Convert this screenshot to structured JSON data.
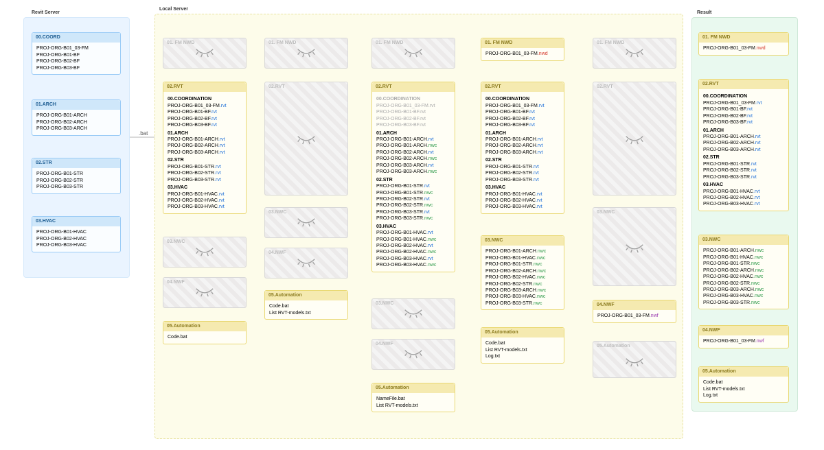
{
  "regions": {
    "revit": {
      "title": "Revit Server"
    },
    "local": {
      "title": "Local Server"
    },
    "result": {
      "title": "Result"
    }
  },
  "bat_label": ".bat",
  "closed_titles": {
    "fm_nwd": "01. FM NWD",
    "rvt": "02.RVT",
    "nwc": "03.NWC",
    "nwf": "04.NWF",
    "automation": "05.Automation"
  },
  "revit": {
    "coord": {
      "title": "00.COORD",
      "items": [
        "PROJ-ORG-B01_03-FM",
        "PROJ-ORG-B01-BF",
        "PROJ-ORG-B02-BF",
        "PROJ-ORG-B03-BF"
      ]
    },
    "arch": {
      "title": "01.ARCH",
      "items": [
        "PROJ-ORG-B01-ARCH",
        "PROJ-ORG-B02-ARCH",
        "PROJ-ORG-B03-ARCH"
      ]
    },
    "str": {
      "title": "02.STR",
      "items": [
        "PROJ-ORG-B01-STR",
        "PROJ-ORG-B02-STR",
        "PROJ-ORG-B03-STR"
      ]
    },
    "hvac": {
      "title": "03.HVAC",
      "items": [
        "PROJ-ORG-B01-HVAC",
        "PROJ-ORG-B02-HVAC",
        "PROJ-ORG-B03-HVAC"
      ]
    }
  },
  "step2_rvt": {
    "title": "02.RVT",
    "sections": [
      {
        "name": "00.COORDINATION",
        "items": [
          {
            "t": "PROJ-ORG-B01_03-FM",
            "e": "rvt"
          },
          {
            "t": "PROJ-ORG-B01-BF",
            "e": "rvt"
          },
          {
            "t": "PROJ-ORG-B02-BF",
            "e": "rvt"
          },
          {
            "t": "PROJ-ORG-B03-BF",
            "e": "rvt"
          }
        ]
      },
      {
        "name": "01.ARCH",
        "items": [
          {
            "t": "PROJ-ORG-B01-ARCH",
            "e": "rvt"
          },
          {
            "t": "PROJ-ORG-B02-ARCH",
            "e": "rvt"
          },
          {
            "t": "PROJ-ORG-B03-ARCH",
            "e": "rvt"
          }
        ]
      },
      {
        "name": "02.STR",
        "items": [
          {
            "t": "PROJ-ORG-B01-STR",
            "e": "rvt"
          },
          {
            "t": "PROJ-ORG-B02-STR",
            "e": "rvt"
          },
          {
            "t": "PROJ-ORG-B03-STR",
            "e": "rvt"
          }
        ]
      },
      {
        "name": "03.HVAC",
        "items": [
          {
            "t": "PROJ-ORG-B01-HVAC",
            "e": "rvt"
          },
          {
            "t": "PROJ-ORG-B02-HVAC",
            "e": "rvt"
          },
          {
            "t": "PROJ-ORG-B03-HVAC",
            "e": "rvt"
          }
        ]
      }
    ]
  },
  "step2_auto": {
    "title": "05.Automation",
    "items": [
      "Code.bat"
    ]
  },
  "step3_auto": {
    "title": "05.Automation",
    "items": [
      "Code.bat",
      "List RVT-models.txt"
    ]
  },
  "step4_rvt": {
    "title": "02.RVT",
    "sections": [
      {
        "name": "00.COORDINATION",
        "grey": true,
        "items": [
          {
            "t": "PROJ-ORG-B01_03-FM",
            "e": "rvt"
          },
          {
            "t": "PROJ-ORG-B01-BF",
            "e": "rvt"
          },
          {
            "t": "PROJ-ORG-B02-BF",
            "e": "rvt"
          },
          {
            "t": "PROJ-ORG-B03-BF",
            "e": "rvt"
          }
        ]
      },
      {
        "name": "01.ARCH",
        "items": [
          {
            "t": "PROJ-ORG-B01-ARCH",
            "e": "rvt"
          },
          {
            "t": "PROJ-ORG-B01-ARCH",
            "e": "nwc"
          },
          {
            "t": "PROJ-ORG-B02-ARCH",
            "e": "rvt"
          },
          {
            "t": "PROJ-ORG-B02-ARCH",
            "e": "nwc"
          },
          {
            "t": "PROJ-ORG-B03-ARCH",
            "e": "rvt"
          },
          {
            "t": "PROJ-ORG-B03-ARCH",
            "e": "nwc"
          }
        ]
      },
      {
        "name": "02.STR",
        "items": [
          {
            "t": "PROJ-ORG-B01-STR",
            "e": "rvt"
          },
          {
            "t": "PROJ-ORG-B01-STR",
            "e": "nwc"
          },
          {
            "t": "PROJ-ORG-B02-STR",
            "e": "rvt"
          },
          {
            "t": "PROJ-ORG-B02-STR",
            "e": "nwc"
          },
          {
            "t": "PROJ-ORG-B03-STR",
            "e": "rvt"
          },
          {
            "t": "PROJ-ORG-B03-STR",
            "e": "nwc"
          }
        ]
      },
      {
        "name": "03.HVAC",
        "items": [
          {
            "t": "PROJ-ORG-B01-HVAC",
            "e": "rvt"
          },
          {
            "t": "PROJ-ORG-B01-HVAC",
            "e": "nwc"
          },
          {
            "t": "PROJ-ORG-B02-HVAC",
            "e": "rvt"
          },
          {
            "t": "PROJ-ORG-B02-HVAC",
            "e": "nwc"
          },
          {
            "t": "PROJ-ORG-B03-HVAC",
            "e": "rvt"
          },
          {
            "t": "PROJ-ORG-B03-HVAC",
            "e": "nwc"
          }
        ]
      }
    ]
  },
  "step4_auto": {
    "title": "05.Automation",
    "items": [
      "NameFile.bat",
      "List RVT-models.txt"
    ]
  },
  "step5_fm": {
    "title": "01. FM NWD",
    "items": [
      {
        "t": "PROJ-ORG-B01_03-FM",
        "e": "nwd"
      }
    ]
  },
  "step5_rvt": {
    "title": "02.RVT",
    "sections": [
      {
        "name": "00.COORDINATION",
        "items": [
          {
            "t": "PROJ-ORG-B01_03-FM",
            "e": "rvt"
          },
          {
            "t": "PROJ-ORG-B01-BF",
            "e": "rvt"
          },
          {
            "t": "PROJ-ORG-B02-BF",
            "e": "rvt"
          },
          {
            "t": "PROJ-ORG-B03-BF",
            "e": "rvt"
          }
        ]
      },
      {
        "name": "01.ARCH",
        "items": [
          {
            "t": "PROJ-ORG-B01-ARCH",
            "e": "rvt"
          },
          {
            "t": "PROJ-ORG-B02-ARCH",
            "e": "rvt"
          },
          {
            "t": "PROJ-ORG-B03-ARCH",
            "e": "rvt"
          }
        ]
      },
      {
        "name": "02.STR",
        "items": [
          {
            "t": "PROJ-ORG-B01-STR",
            "e": "rvt"
          },
          {
            "t": "PROJ-ORG-B02-STR",
            "e": "rvt"
          },
          {
            "t": "PROJ-ORG-B03-STR",
            "e": "rvt"
          }
        ]
      },
      {
        "name": "03.HVAC",
        "items": [
          {
            "t": "PROJ-ORG-B01-HVAC",
            "e": "rvt"
          },
          {
            "t": "PROJ-ORG-B02-HVAC",
            "e": "rvt"
          },
          {
            "t": "PROJ-ORG-B03-HVAC",
            "e": "rvt"
          }
        ]
      }
    ]
  },
  "step5_nwc": {
    "title": "03.NWC",
    "items": [
      {
        "t": "PROJ-ORG-B01-ARCH",
        "e": "nwc"
      },
      {
        "t": "PROJ-ORG-B01-HVAC",
        "e": "nwc"
      },
      {
        "t": "PROJ-ORG-B01-STR",
        "e": "nwc"
      },
      {
        "t": "PROJ-ORG-B02-ARCH",
        "e": "nwc"
      },
      {
        "t": "PROJ-ORG-B02-HVAC",
        "e": "nwc"
      },
      {
        "t": "PROJ-ORG-B02-STR",
        "e": "nwc"
      },
      {
        "t": "PROJ-ORG-B03-ARCH",
        "e": "nwc"
      },
      {
        "t": "PROJ-ORG-B03-HVAC",
        "e": "nwc"
      },
      {
        "t": "PROJ-ORG-B03-STR",
        "e": "nwc"
      }
    ]
  },
  "step5_auto": {
    "title": "05.Automation",
    "items": [
      "Code.bat",
      "List RVT-models.txt",
      "Log.txt"
    ]
  },
  "step6_nwf": {
    "title": "04.NWF",
    "items": [
      {
        "t": "PROJ-ORG-B01_03-FM",
        "e": "nwf"
      }
    ]
  },
  "result": {
    "fm": {
      "title": "01. FM NWD",
      "items": [
        {
          "t": "PROJ-ORG-B01_03-FM",
          "e": "nwd"
        }
      ]
    },
    "rvt": {
      "title": "02.RVT",
      "sections": [
        {
          "name": "00.COORDINATION",
          "items": [
            {
              "t": "PROJ-ORG-B01_03-FM",
              "e": "rvt"
            },
            {
              "t": "PROJ-ORG-B01-BF",
              "e": "rvt"
            },
            {
              "t": "PROJ-ORG-B02-BF",
              "e": "rvt"
            },
            {
              "t": "PROJ-ORG-B03-BF",
              "e": "rvt"
            }
          ]
        },
        {
          "name": "01.ARCH",
          "items": [
            {
              "t": "PROJ-ORG-B01-ARCH",
              "e": "rvt"
            },
            {
              "t": "PROJ-ORG-B02-ARCH",
              "e": "rvt"
            },
            {
              "t": "PROJ-ORG-B03-ARCH",
              "e": "rvt"
            }
          ]
        },
        {
          "name": "02.STR",
          "items": [
            {
              "t": "PROJ-ORG-B01-STR",
              "e": "rvt"
            },
            {
              "t": "PROJ-ORG-B02-STR",
              "e": "rvt"
            },
            {
              "t": "PROJ-ORG-B03-STR",
              "e": "rvt"
            }
          ]
        },
        {
          "name": "03.HVAC",
          "items": [
            {
              "t": "PROJ-ORG-B01-HVAC",
              "e": "rvt"
            },
            {
              "t": "PROJ-ORG-B02-HVAC",
              "e": "rvt"
            },
            {
              "t": "PROJ-ORG-B03-HVAC",
              "e": "rvt"
            }
          ]
        }
      ]
    },
    "nwc": {
      "title": "03.NWC",
      "items": [
        {
          "t": "PROJ-ORG-B01-ARCH",
          "e": "nwc"
        },
        {
          "t": "PROJ-ORG-B01-HVAC",
          "e": "nwc"
        },
        {
          "t": "PROJ-ORG-B01-STR",
          "e": "nwc"
        },
        {
          "t": "PROJ-ORG-B02-ARCH",
          "e": "nwc"
        },
        {
          "t": "PROJ-ORG-B02-HVAC",
          "e": "nwc"
        },
        {
          "t": "PROJ-ORG-B02-STR",
          "e": "nwc"
        },
        {
          "t": "PROJ-ORG-B03-ARCH",
          "e": "nwc"
        },
        {
          "t": "PROJ-ORG-B03-HVAC",
          "e": "nwc"
        },
        {
          "t": "PROJ-ORG-B03-STR",
          "e": "nwc"
        }
      ]
    },
    "nwf": {
      "title": "04.NWF",
      "items": [
        {
          "t": "PROJ-ORG-B01_03-FM",
          "e": "nwf"
        }
      ]
    },
    "auto": {
      "title": "05.Automation",
      "items": [
        "Code.bat",
        "List RVT-models.txt",
        "Log.txt"
      ]
    }
  }
}
